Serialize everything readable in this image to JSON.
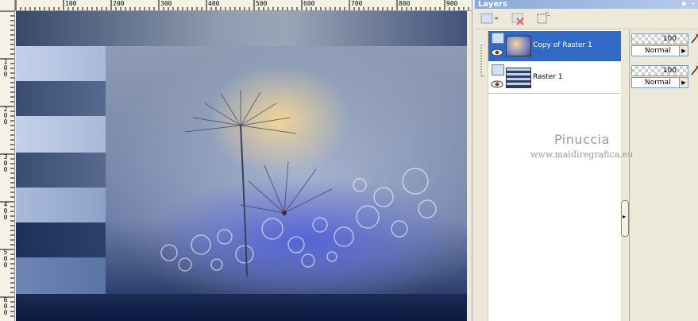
{
  "panel": {
    "title": "Layers",
    "title_buttons": [
      "pin-icon",
      "minimize-icon"
    ],
    "toolbar": [
      "new-layer-icon",
      "delete-layer-icon",
      "mask-icon"
    ]
  },
  "layers": [
    {
      "name": "Copy of Raster 1",
      "selected": true,
      "opacity": "100",
      "blend_mode": "Normal",
      "thumb": "photo-thumbnail"
    },
    {
      "name": "Raster 1",
      "selected": false,
      "opacity": "100",
      "blend_mode": "Normal",
      "thumb": "stripes-thumbnail"
    }
  ],
  "ruler": {
    "top_labels": [
      "100",
      "200",
      "300",
      "400",
      "500",
      "600",
      "700",
      "800",
      "900"
    ],
    "left_labels": [
      "100",
      "200",
      "300",
      "400",
      "500",
      "600"
    ]
  },
  "watermark": {
    "name": "Pinuccia",
    "url": "www.maidiregrafica.eu"
  },
  "colors": {
    "selection": "#316AC5",
    "panel_bg": "#ECE9D8",
    "stripe_dark": "#2c3f66",
    "stripe_light": "#c4d1ea"
  }
}
